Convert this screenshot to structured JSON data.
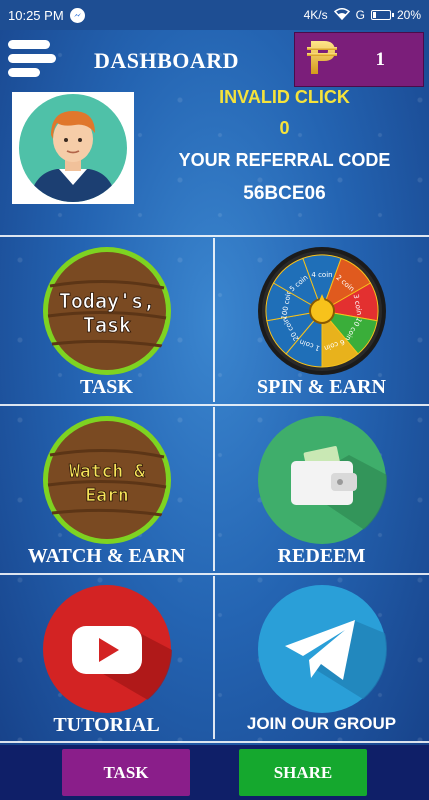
{
  "status_bar": {
    "time": "10:25 PM",
    "network": "4K/s",
    "signal": "G",
    "battery": "20%",
    "battery_level": 0.2,
    "icons": [
      "messenger-icon",
      "wifi-icon",
      "signal-icon",
      "battery-icon"
    ]
  },
  "header": {
    "title": "DASHBOARD",
    "menu_icon": "hamburger-icon",
    "currency_icon": "peso-icon",
    "coin_balance": "1"
  },
  "profile": {
    "avatar_icon": "avatar-icon",
    "invalid_click_label": "INVALID CLICK",
    "invalid_click_value": "0",
    "referral_label": "YOUR REFERRAL CODE",
    "referral_code": "56BCE06"
  },
  "tiles": [
    {
      "label": "TASK",
      "image_text": "Today's, Task",
      "icon": "todays-task-icon"
    },
    {
      "label": "SPIN & EARN",
      "icon": "spin-wheel-icon",
      "wheel_labels": [
        "4 coin",
        "2 coin",
        "3 coin",
        "10 coin",
        "6 coin",
        "1 coin",
        "20 coin",
        "100 coin",
        "5 coin"
      ]
    },
    {
      "label": "WATCH & EARN",
      "image_text": "Watch & Earn",
      "icon": "watch-earn-icon"
    },
    {
      "label": "REDEEM",
      "icon": "wallet-icon"
    },
    {
      "label": "TUTORIAL",
      "icon": "youtube-icon"
    },
    {
      "label": "JOIN OUR GROUP",
      "icon": "telegram-icon"
    }
  ],
  "bottom_bar": {
    "task_button": "TASK",
    "share_button": "SHARE"
  },
  "colors": {
    "background": "#2464b2",
    "coin_box": "#7b1e7a",
    "highlight_yellow": "#f5e33b",
    "task_button": "#8a1e8a",
    "share_button": "#15a82e",
    "bottom_bar": "#0f1f68"
  }
}
